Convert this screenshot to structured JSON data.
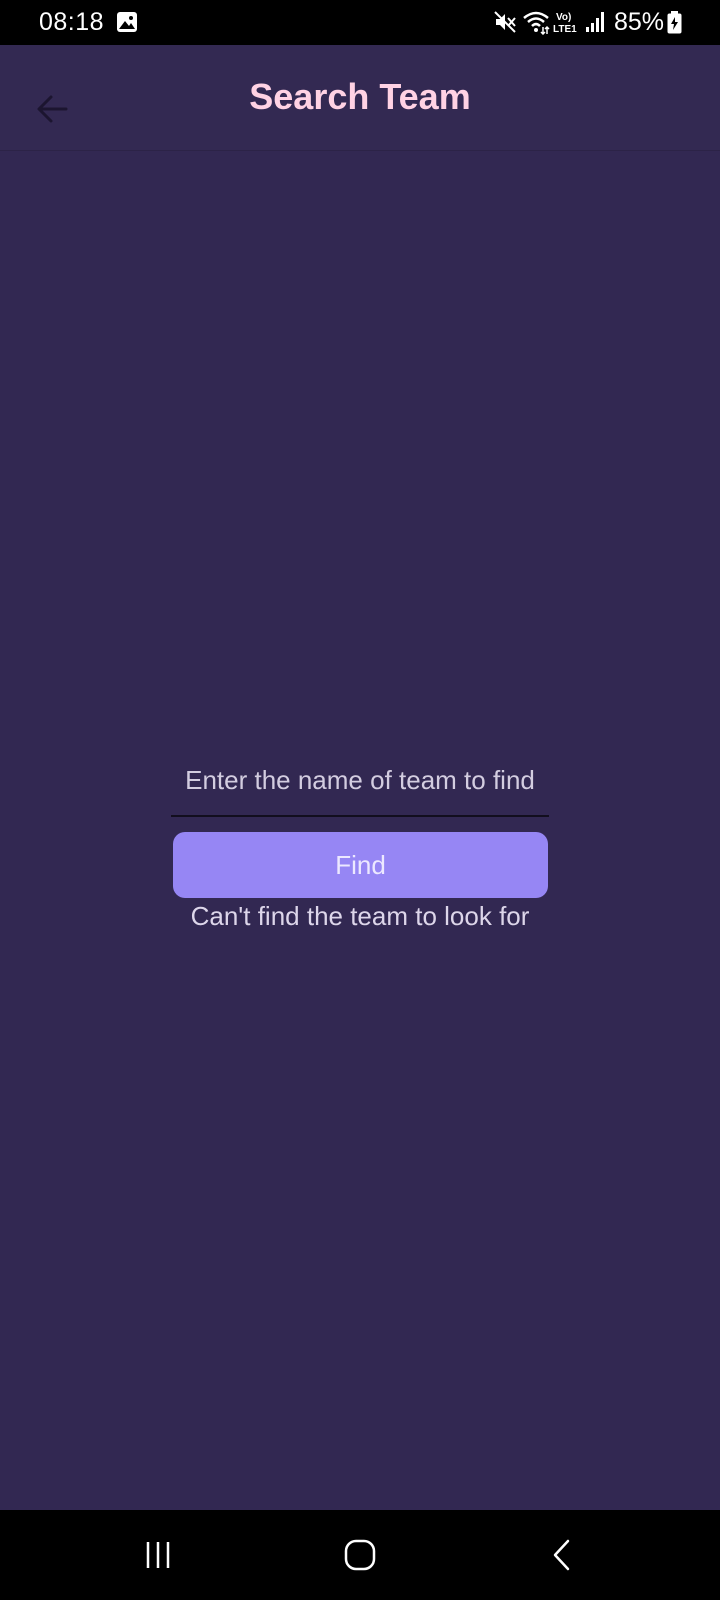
{
  "status_bar": {
    "time": "08:18",
    "battery": "85%",
    "icons": [
      "gallery-icon",
      "mute-icon",
      "wifi-icon",
      "volte-icon",
      "signal-icon",
      "battery-charging-icon"
    ]
  },
  "app_bar": {
    "title": "Search Team",
    "back_icon": "arrow-left-icon"
  },
  "search": {
    "placeholder": "Enter the name of team to find",
    "value": ""
  },
  "find_button": {
    "label": "Find"
  },
  "help_text": "Can't find the team to look for",
  "nav_bar": {
    "icons": [
      "recents-icon",
      "home-icon",
      "back-icon"
    ]
  },
  "colors": {
    "background": "#322852",
    "title": "#ffd2e4",
    "button": "#9686f4",
    "text": "#ddd6ea"
  }
}
